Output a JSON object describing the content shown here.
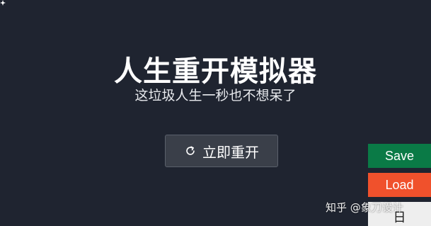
{
  "header": {
    "title": "人生重开模拟器",
    "subtitle": "这垃圾人生一秒也不想呆了"
  },
  "main": {
    "restart_label": "立即重开",
    "restart_icon": "refresh-icon"
  },
  "side_buttons": {
    "save_label": "Save",
    "load_label": "Load",
    "extra_label": "日",
    "save_color": "#0a7a46",
    "load_color": "#f0512c"
  },
  "watermark": {
    "text": "知乎 @象刀设计"
  },
  "colors": {
    "background": "#1f2430",
    "button_bg": "#3a3f49"
  }
}
